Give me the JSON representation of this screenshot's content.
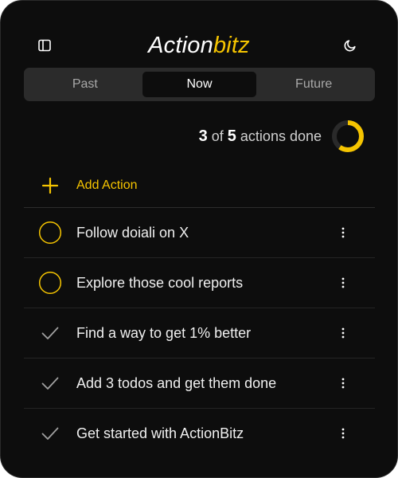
{
  "app": {
    "logo_part1": "Action",
    "logo_part2": "bitz"
  },
  "header": {
    "left_icon": "sidebar-panel-icon",
    "right_icon": "moon-icon"
  },
  "tabs": [
    {
      "label": "Past",
      "active": false
    },
    {
      "label": "Now",
      "active": true
    },
    {
      "label": "Future",
      "active": false
    }
  ],
  "progress": {
    "done": "3",
    "of_text": "of",
    "total": "5",
    "suffix": "actions done",
    "fraction": 0.6
  },
  "add_action": {
    "icon": "plus-icon",
    "label": "Add Action"
  },
  "items": [
    {
      "text": "Follow doiali on X",
      "done": false
    },
    {
      "text": "Explore those cool reports",
      "done": false
    },
    {
      "text": "Find a way to get 1% better",
      "done": true
    },
    {
      "text": "Add 3 todos and get them done",
      "done": true
    },
    {
      "text": "Get started with ActionBitz",
      "done": true
    }
  ],
  "colors": {
    "background": "#0d0d0d",
    "accent": "#f5c400",
    "tab_bar": "#2b2b2b",
    "text": "#f0f0f0",
    "muted": "#a8a8a8"
  }
}
